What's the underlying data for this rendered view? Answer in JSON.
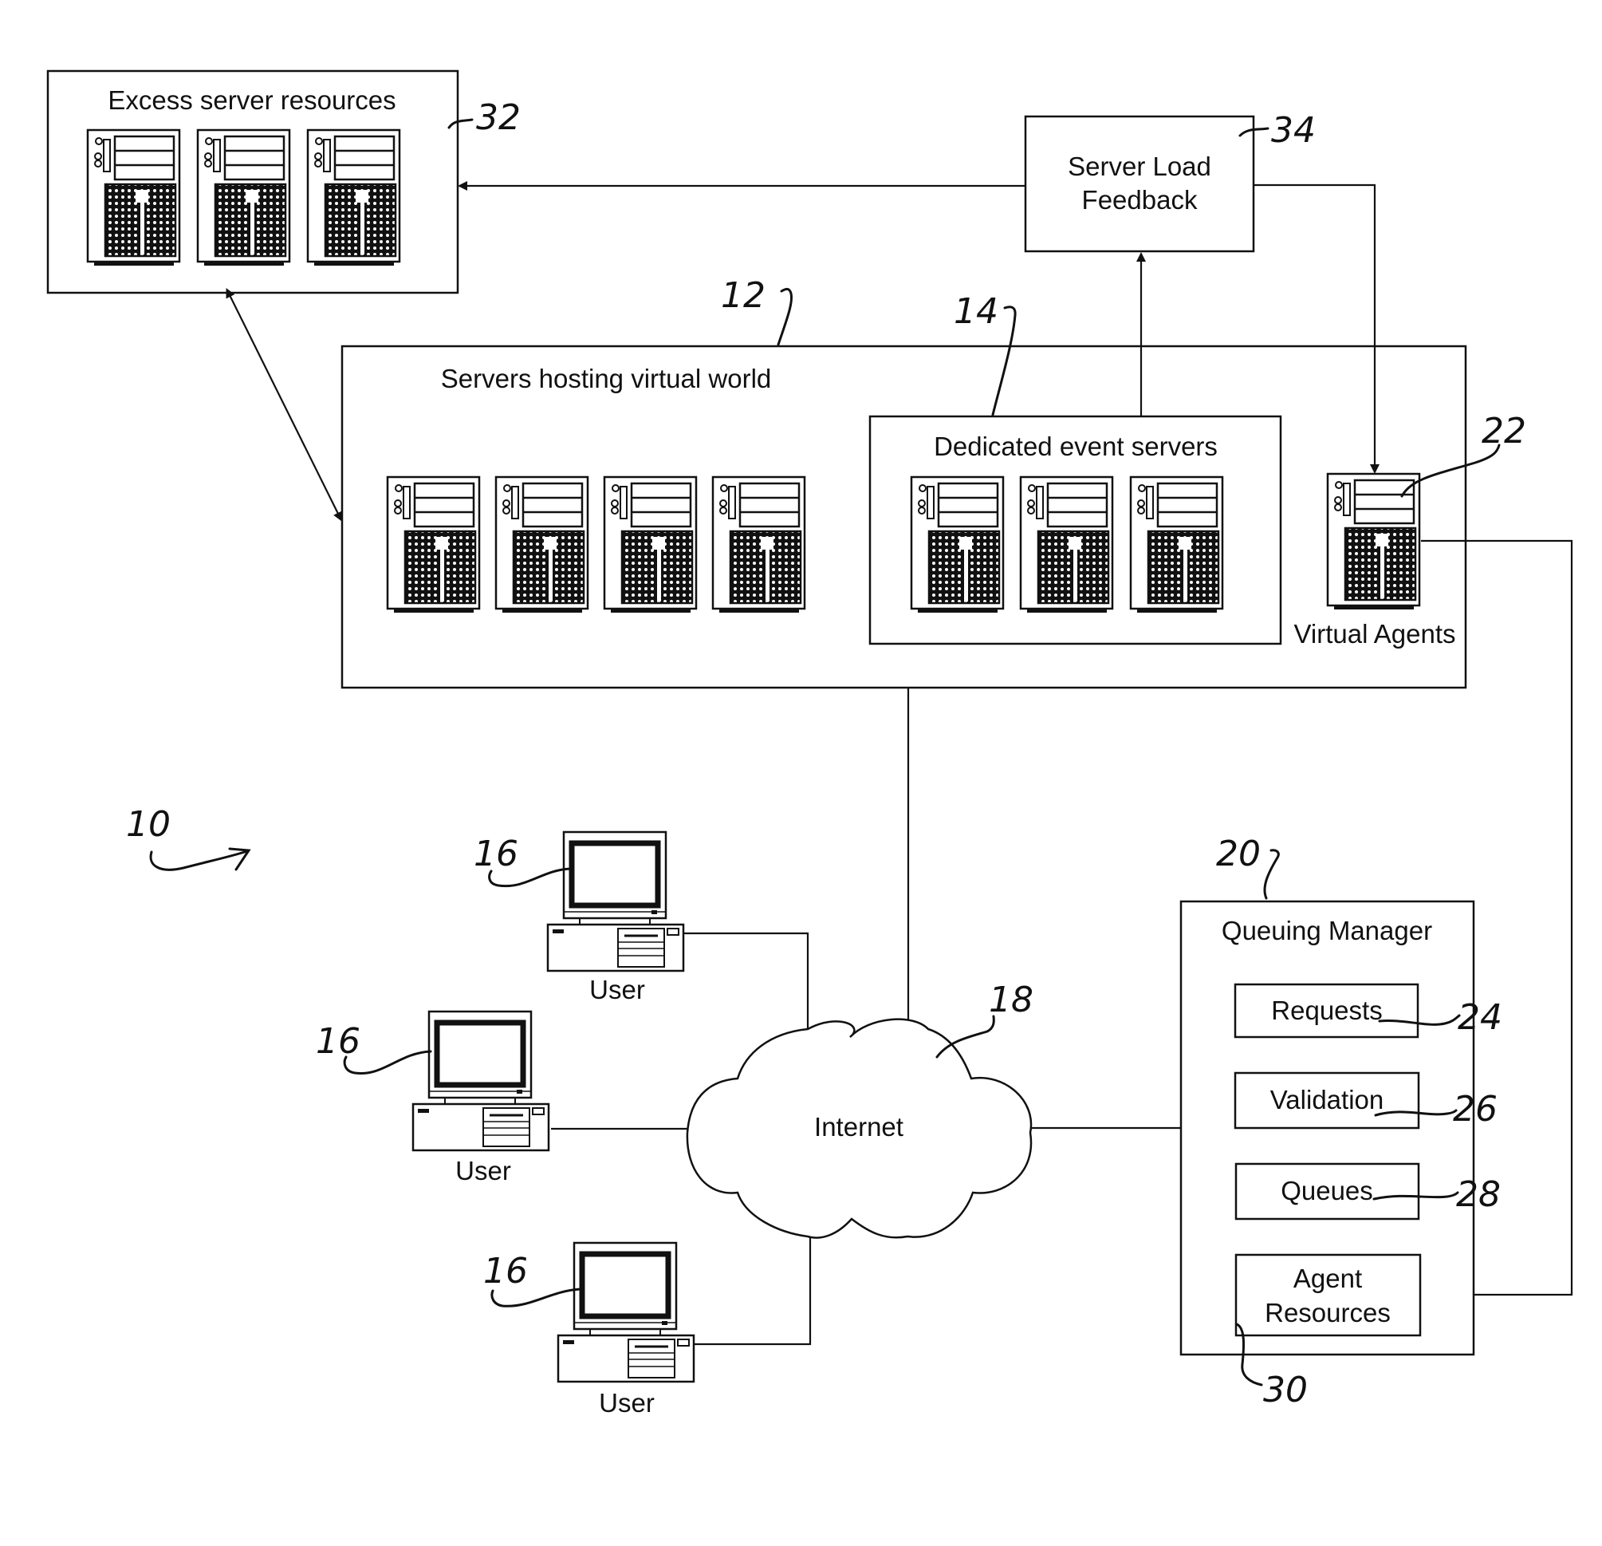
{
  "figure": {
    "system_ref": "10",
    "excess_servers": {
      "title": "Excess server resources",
      "ref": "32",
      "server_count": 3
    },
    "server_load_feedback": {
      "line1": "Server Load",
      "line2": "Feedback",
      "ref": "34"
    },
    "hosting_servers": {
      "title": "Servers hosting virtual world",
      "ref": "12",
      "server_count": 4
    },
    "dedicated_event_servers": {
      "title": "Dedicated event servers",
      "ref": "14",
      "server_count": 3
    },
    "virtual_agents": {
      "label": "Virtual Agents",
      "ref": "22"
    },
    "internet": {
      "label": "Internet",
      "ref": "18"
    },
    "users": [
      {
        "label": "User",
        "ref": "16"
      },
      {
        "label": "User",
        "ref": "16"
      },
      {
        "label": "User",
        "ref": "16"
      }
    ],
    "queuing_manager": {
      "title": "Queuing Manager",
      "ref": "20",
      "components": [
        {
          "label": "Requests",
          "ref": "24"
        },
        {
          "label": "Validation",
          "ref": "26"
        },
        {
          "label": "Queues",
          "ref": "28"
        },
        {
          "label_line1": "Agent",
          "label_line2": "Resources",
          "ref": "30"
        }
      ]
    }
  }
}
